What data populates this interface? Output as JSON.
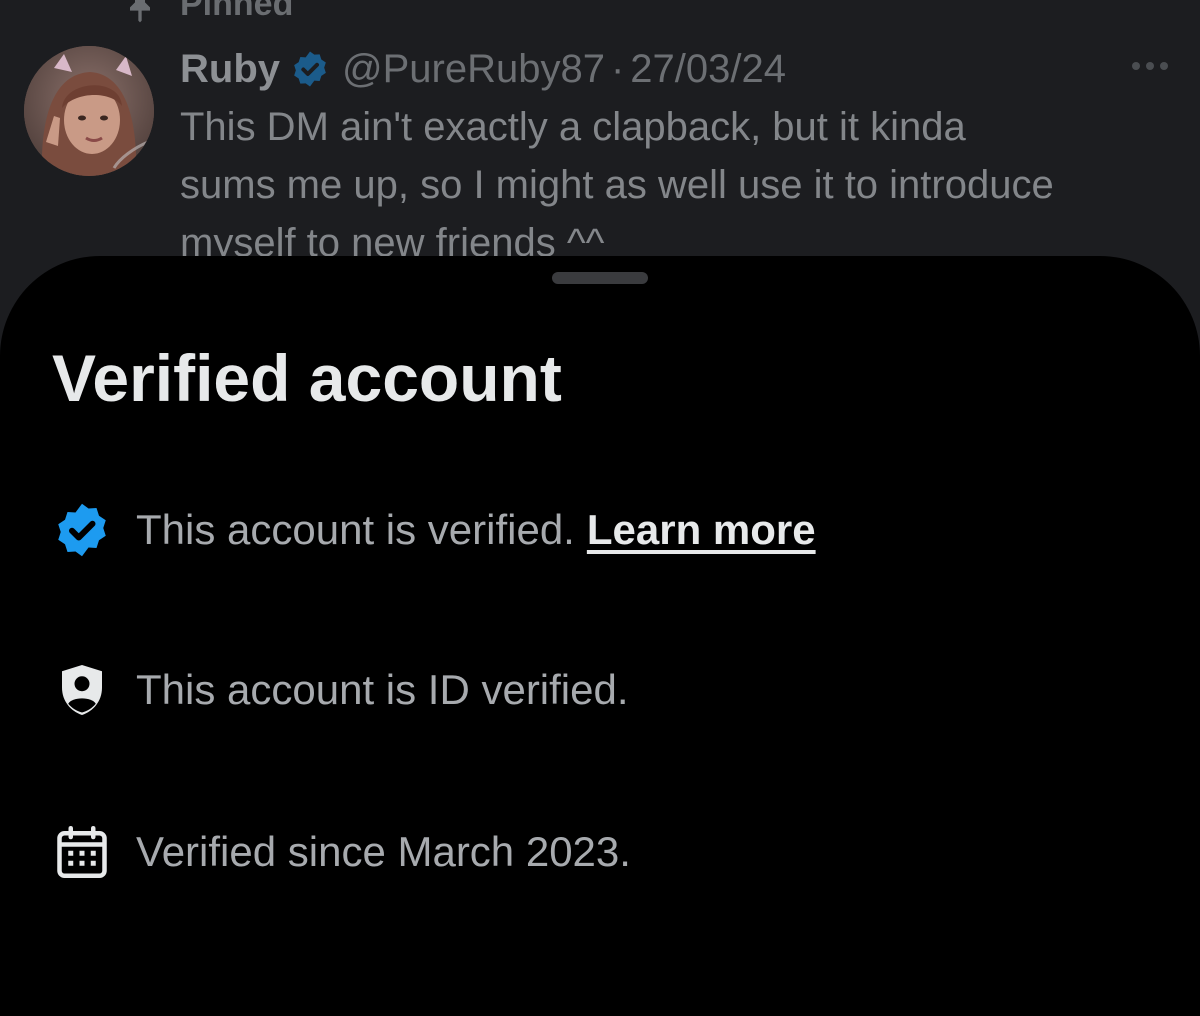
{
  "tweet": {
    "pinned_label": "Pinned",
    "author_name": "Ruby",
    "author_handle": "@PureRuby87",
    "separator": "·",
    "date": "27/03/24",
    "text": "This DM ain't exactly a clapback, but it kinda\nsums me up, so I might as well use it to introduce\nmyself to new friends ^^",
    "icons": {
      "pin": "pin-icon",
      "badge": "verified-badge-icon",
      "more": "more-horizontal-icon"
    }
  },
  "sheet": {
    "title": "Verified account",
    "rows": [
      {
        "icon": "verified-badge-icon",
        "text": "This account is verified.",
        "link": "Learn more"
      },
      {
        "icon": "id-shield-icon",
        "text": "This account is ID verified."
      },
      {
        "icon": "calendar-icon",
        "text": "Verified since March 2023."
      }
    ]
  },
  "colors": {
    "verified_blue": "#1d9bf0",
    "sheet_background": "#000000",
    "backdrop": "#1c1d20",
    "title_text": "#e7e9ea",
    "body_text": "#a7aaae"
  }
}
